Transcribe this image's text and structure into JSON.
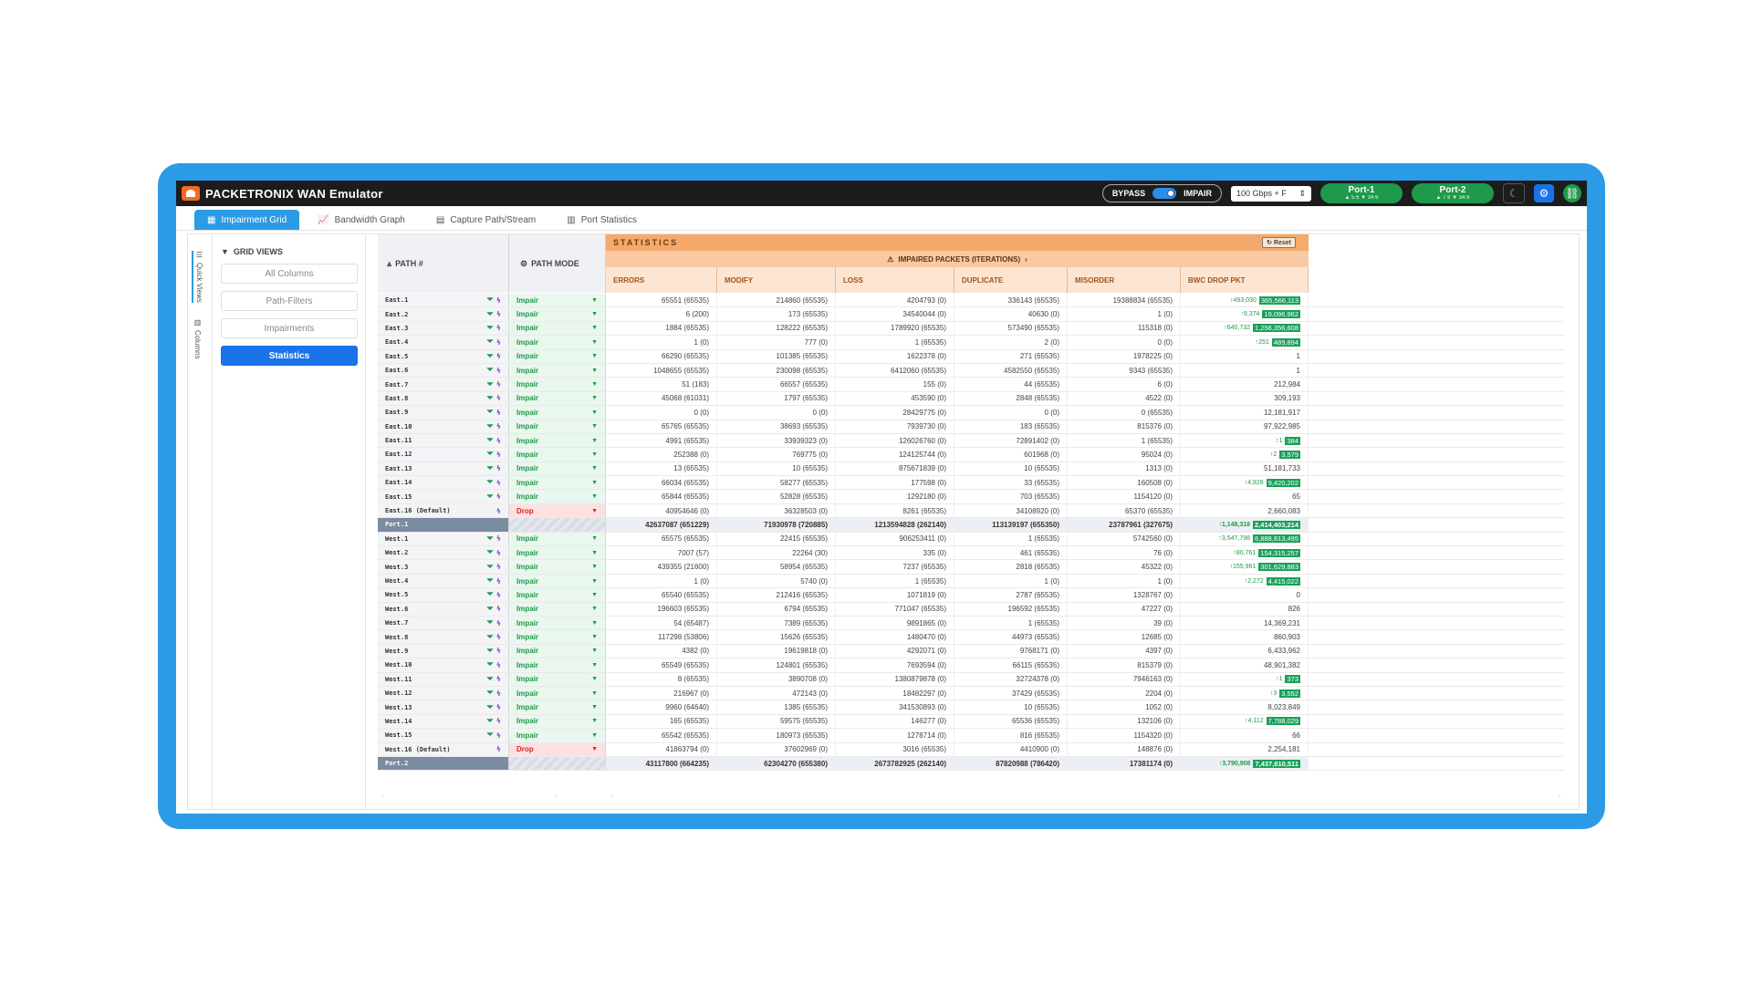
{
  "app": {
    "title": "PACKETRONIX WAN Emulator",
    "bypass": "BYPASS",
    "impair": "IMPAIR",
    "speed": "100 Gbps + F",
    "port1": {
      "label": "Port-1",
      "sub": "▲ 5 6 ▼ 34 6"
    },
    "port2": {
      "label": "Port-2",
      "sub": "▲ 7 8 ▼ 34 6"
    },
    "accent": "#2b9be6"
  },
  "tabs": [
    {
      "label": "Impairment Grid"
    },
    {
      "label": "Bandwidth Graph"
    },
    {
      "label": "Capture Path/Stream"
    },
    {
      "label": "Port Statistics"
    }
  ],
  "side": {
    "quick": "Quick Views",
    "columns": "Columns"
  },
  "gridviews": {
    "title": "GRID VIEWS",
    "items": [
      "All Columns",
      "Path-Filters",
      "Impairments",
      "Statistics"
    ]
  },
  "grid": {
    "path_header": "PATH #",
    "mode_header": "PATH MODE",
    "stats_title": "STATISTICS",
    "reset": "Reset",
    "impaired": "IMPAIRED PACKETS (ITERATIONS)",
    "columns": [
      "ERRORS",
      "MODIFY",
      "LOSS",
      "DUPLICATE",
      "MISORDER",
      "BWC DROP PKT"
    ]
  },
  "rows": [
    {
      "path": "East.1",
      "mode": "Impair",
      "v": [
        "65551 (65535)",
        "214860 (65535)",
        "4204793 (0)",
        "336143 (65535)",
        "19388834 (65535)"
      ],
      "up": "↑493,030",
      "hl": "365,566,113"
    },
    {
      "path": "East.2",
      "mode": "Impair",
      "v": [
        "6 (200)",
        "173 (65535)",
        "34540044 (0)",
        "40630 (0)",
        "1 (0)"
      ],
      "up": "↑9,374",
      "hl": "19,096,962"
    },
    {
      "path": "East.3",
      "mode": "Impair",
      "v": [
        "1884 (65535)",
        "128222 (65535)",
        "1789920 (65535)",
        "573490 (65535)",
        "115318 (0)"
      ],
      "up": "↑640,732",
      "hl": "1,256,356,608"
    },
    {
      "path": "East.4",
      "mode": "Impair",
      "v": [
        "1 (0)",
        "777 (0)",
        "1 (65535)",
        "2 (0)",
        "0 (0)"
      ],
      "up": "↑251",
      "hl": "489,894"
    },
    {
      "path": "East.5",
      "mode": "Impair",
      "v": [
        "66290 (65535)",
        "101385 (65535)",
        "1622378 (0)",
        "271 (65535)",
        "1978225 (0)"
      ],
      "bwc": "1"
    },
    {
      "path": "East.6",
      "mode": "Impair",
      "v": [
        "1048655 (65535)",
        "230098 (65535)",
        "6412060 (65535)",
        "4582550 (65535)",
        "9343 (65535)"
      ],
      "bwc": "1"
    },
    {
      "path": "East.7",
      "mode": "Impair",
      "v": [
        "51 (183)",
        "66557 (65535)",
        "155 (0)",
        "44 (65535)",
        "6 (0)"
      ],
      "bwc": "212,984"
    },
    {
      "path": "East.8",
      "mode": "Impair",
      "v": [
        "45068 (61031)",
        "1797 (65535)",
        "453590 (0)",
        "2848 (65535)",
        "4522 (0)"
      ],
      "bwc": "309,193"
    },
    {
      "path": "East.9",
      "mode": "Impair",
      "v": [
        "0 (0)",
        "0 (0)",
        "28429775 (0)",
        "0 (0)",
        "0 (65535)"
      ],
      "bwc": "12,181,917"
    },
    {
      "path": "East.10",
      "mode": "Impair",
      "v": [
        "65765 (65535)",
        "38693 (65535)",
        "7939730 (0)",
        "183 (65535)",
        "815376 (0)"
      ],
      "bwc": "97,922,985"
    },
    {
      "path": "East.11",
      "mode": "Impair",
      "v": [
        "4991 (65535)",
        "33939323 (0)",
        "126026760 (0)",
        "72891402 (0)",
        "1 (65535)"
      ],
      "up": "↑1",
      "hl": "384"
    },
    {
      "path": "East.12",
      "mode": "Impair",
      "v": [
        "252388 (0)",
        "769775 (0)",
        "124125744 (0)",
        "601968 (0)",
        "95024 (0)"
      ],
      "up": "↑2",
      "hl": "3,579"
    },
    {
      "path": "East.13",
      "mode": "Impair",
      "v": [
        "13 (65535)",
        "10 (65535)",
        "875671839 (0)",
        "10 (65535)",
        "1313 (0)"
      ],
      "bwc": "51,181,733"
    },
    {
      "path": "East.14",
      "mode": "Impair",
      "v": [
        "66034 (65535)",
        "58277 (65535)",
        "177598 (0)",
        "33 (65535)",
        "160508 (0)"
      ],
      "up": "↑4,928",
      "hl": "9,420,202"
    },
    {
      "path": "East.15",
      "mode": "Impair",
      "v": [
        "65844 (65535)",
        "52828 (65535)",
        "1292180 (0)",
        "703 (65535)",
        "1154120 (0)"
      ],
      "bwc": "65"
    },
    {
      "path": "East.16 (Default)",
      "mode": "Drop",
      "v": [
        "40954646 (0)",
        "36328503 (0)",
        "8261 (65535)",
        "34108920 (0)",
        "65370 (65535)"
      ],
      "bwc": "2,660,083"
    },
    {
      "path": "Port.1",
      "port": true,
      "v": [
        "42637087 (651229)",
        "71930978 (720885)",
        "1213594828 (262140)",
        "113139197 (655350)",
        "23787961 (327675)"
      ],
      "up": "↑1,148,318",
      "hl": "2,414,403,214"
    },
    {
      "path": "West.1",
      "mode": "Impair",
      "v": [
        "65575 (65535)",
        "22415 (65535)",
        "906253411 (0)",
        "1 (65535)",
        "5742560 (0)"
      ],
      "up": "↑3,547,798",
      "hl": "6,888,813,495"
    },
    {
      "path": "West.2",
      "mode": "Impair",
      "v": [
        "7007 (57)",
        "22264 (30)",
        "335 (0)",
        "461 (65535)",
        "76 (0)"
      ],
      "up": "↑80,761",
      "hl": "154,315,257"
    },
    {
      "path": "West.3",
      "mode": "Impair",
      "v": [
        "439355 (21600)",
        "58954 (65535)",
        "7237 (65535)",
        "2818 (65535)",
        "45322 (0)"
      ],
      "up": "↑155,961",
      "hl": "301,629,883"
    },
    {
      "path": "West.4",
      "mode": "Impair",
      "v": [
        "1 (0)",
        "5740 (0)",
        "1 (65535)",
        "1 (0)",
        "1 (0)"
      ],
      "up": "↑2,272",
      "hl": "4,415,022"
    },
    {
      "path": "West.5",
      "mode": "Impair",
      "v": [
        "65540 (65535)",
        "212416 (65535)",
        "1071819 (0)",
        "2787 (65535)",
        "1328767 (0)"
      ],
      "bwc": "0"
    },
    {
      "path": "West.6",
      "mode": "Impair",
      "v": [
        "196603 (65535)",
        "6794 (65535)",
        "771047 (65535)",
        "196592 (65535)",
        "47227 (0)"
      ],
      "bwc": "826"
    },
    {
      "path": "West.7",
      "mode": "Impair",
      "v": [
        "54 (65487)",
        "7389 (65535)",
        "9891865 (0)",
        "1 (65535)",
        "39 (0)"
      ],
      "bwc": "14,369,231"
    },
    {
      "path": "West.8",
      "mode": "Impair",
      "v": [
        "117298 (53806)",
        "15626 (65535)",
        "1480470 (0)",
        "44973 (65535)",
        "12685 (0)"
      ],
      "bwc": "860,903"
    },
    {
      "path": "West.9",
      "mode": "Impair",
      "v": [
        "4382 (0)",
        "19619818 (0)",
        "4292071 (0)",
        "9768171 (0)",
        "4397 (0)"
      ],
      "bwc": "6,433,962"
    },
    {
      "path": "West.10",
      "mode": "Impair",
      "v": [
        "65549 (65535)",
        "124801 (65535)",
        "7693594 (0)",
        "66115 (65535)",
        "815379 (0)"
      ],
      "bwc": "48,901,382"
    },
    {
      "path": "West.11",
      "mode": "Impair",
      "v": [
        "8 (65535)",
        "3890708 (0)",
        "1380879878 (0)",
        "32724378 (0)",
        "7946163 (0)"
      ],
      "up": "↑1",
      "hl": "373"
    },
    {
      "path": "West.12",
      "mode": "Impair",
      "v": [
        "216967 (0)",
        "472143 (0)",
        "18482297 (0)",
        "37429 (65535)",
        "2204 (0)"
      ],
      "up": "↑3",
      "hl": "3,552"
    },
    {
      "path": "West.13",
      "mode": "Impair",
      "v": [
        "9960 (64640)",
        "1385 (65535)",
        "341530893 (0)",
        "10 (65535)",
        "1052 (0)"
      ],
      "bwc": "8,023,849"
    },
    {
      "path": "West.14",
      "mode": "Impair",
      "v": [
        "165 (65535)",
        "59575 (65535)",
        "146277 (0)",
        "65536 (65535)",
        "132106 (0)"
      ],
      "up": "↑4,112",
      "hl": "7,788,029"
    },
    {
      "path": "West.15",
      "mode": "Impair",
      "v": [
        "65542 (65535)",
        "180973 (65535)",
        "1278714 (0)",
        "816 (65535)",
        "1154320 (0)"
      ],
      "bwc": "66"
    },
    {
      "path": "West.16 (Default)",
      "mode": "Drop",
      "v": [
        "41863794 (0)",
        "37602969 (0)",
        "3016 (65535)",
        "4410900 (0)",
        "148876 (0)"
      ],
      "bwc": "2,254,181"
    },
    {
      "path": "Port.2",
      "port": true,
      "v": [
        "43117800 (664235)",
        "62304270 (655380)",
        "2673782925 (262140)",
        "87820988 (786420)",
        "17381174 (0)"
      ],
      "up": "↑3,790,908",
      "hl": "7,437,810,511"
    }
  ]
}
